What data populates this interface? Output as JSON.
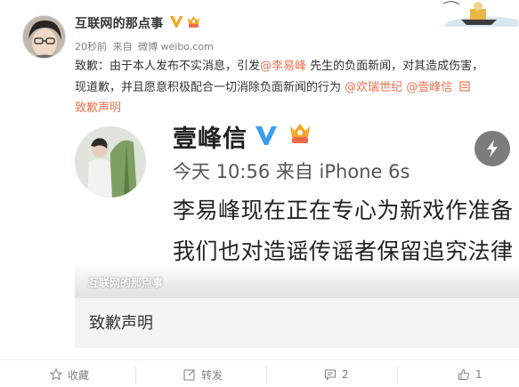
{
  "author": {
    "name": "互联网的那点事"
  },
  "meta": {
    "time": "20秒前",
    "source_prefix": "来自",
    "source": "微博 weibo.com"
  },
  "post": {
    "line1_start": "致歉：由于本人发布不实消息，引发",
    "mention_li": "@李易峰",
    "line1_end": " 先生的负面新闻，对其造成伤害，",
    "line2_start": "现道歉，并且愿意积极配合一切消除负面新闻的行为 ",
    "mention_hr": "@欢瑞世纪",
    "mention_yfx": " @壹峰信",
    "link_label": "致歉声明"
  },
  "media": {
    "inner_name": "壹峰信",
    "inner_meta": "今天 10:56 来自 iPhone 6s",
    "inner_line1": "李易峰现在正在专心为新戏作准备",
    "inner_line2": "我们也对造谣传谣者保留追究法律",
    "watermark": "互联网的那点事",
    "caption": "致歉声明"
  },
  "actions": {
    "favorite_label": "收藏",
    "repost_label": "转发",
    "comment_count": "2",
    "like_count": "1"
  },
  "colors": {
    "mention": "#eb7350",
    "verified": "#f5a623",
    "inner_verified": "#3a9df2",
    "meta": "#808080"
  },
  "icons": [
    "verified-icon",
    "vip-icon",
    "link-icon",
    "flash-icon",
    "star-icon",
    "repost-icon",
    "comment-icon",
    "thumbs-up-icon"
  ]
}
